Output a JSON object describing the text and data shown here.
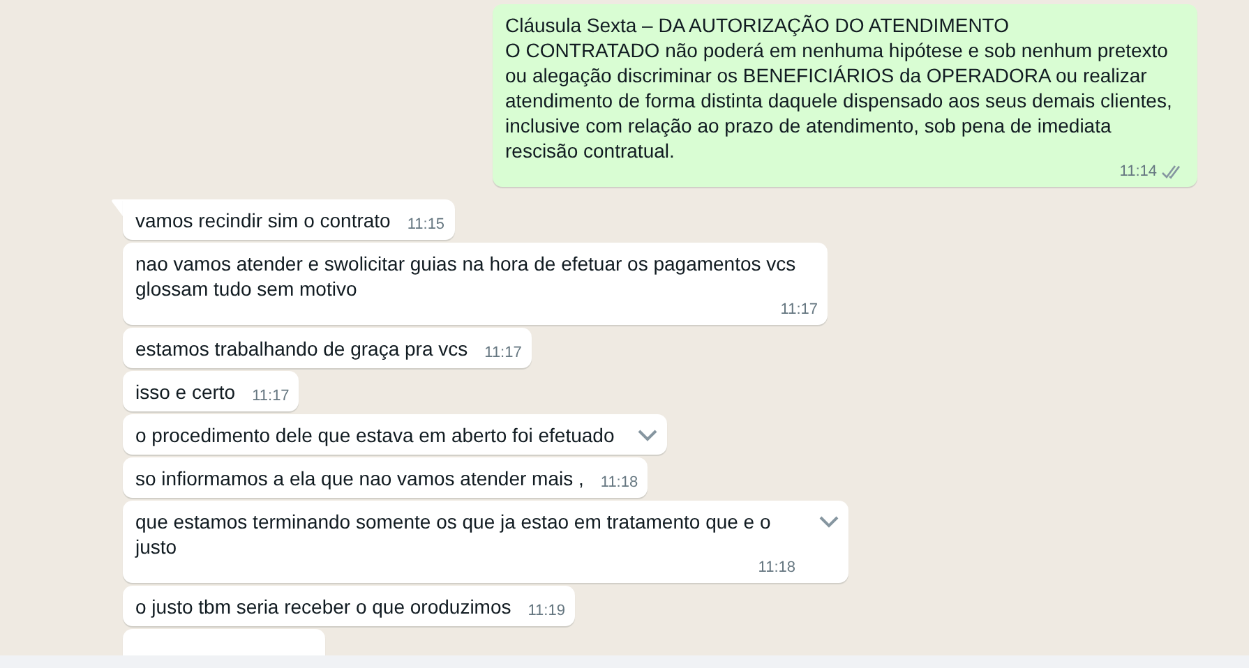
{
  "messages": [
    {
      "kind": "outgoing",
      "text": "Cláusula Sexta – DA AUTORIZAÇÃO DO ATENDIMENTO\nO CONTRATADO não poderá em nenhuma hipótese e sob nenhum pretexto ou alegação discriminar os BENEFICIÁRIOS da OPERADORA ou realizar atendimento de forma distinta daquele dispensado aos seus demais clientes, inclusive com relação ao prazo de atendimento, sob pena de imediata rescisão contratual.",
      "time": "11:14",
      "read": false
    },
    {
      "kind": "incoming",
      "tail": true,
      "text": "vamos recindir sim o contrato",
      "time": "11:15"
    },
    {
      "kind": "incoming",
      "text": "nao vamos atender e swolicitar guias na hora de efetuar os pagamentos vcs glossam tudo sem motivo",
      "time": "11:17"
    },
    {
      "kind": "incoming",
      "text": "estamos trabalhando de graça pra vcs",
      "time": "11:17"
    },
    {
      "kind": "incoming",
      "text": "isso e certo",
      "time": "11:17"
    },
    {
      "kind": "incoming",
      "text": "o procedimento dele que estava em aberto foi efetuado",
      "menu_open": true
    },
    {
      "kind": "incoming",
      "text": "so infiormamos a ela que nao vamos atender mais ,",
      "time": "11:18"
    },
    {
      "kind": "incoming",
      "text": "que estamos terminando somente os que ja estao em tratamento que e o justo",
      "time": "11:18",
      "menu_open": true
    },
    {
      "kind": "incoming",
      "text": "o justo tbm seria receber o que oroduzimos",
      "time": "11:19"
    },
    {
      "kind": "incoming"
    }
  ]
}
